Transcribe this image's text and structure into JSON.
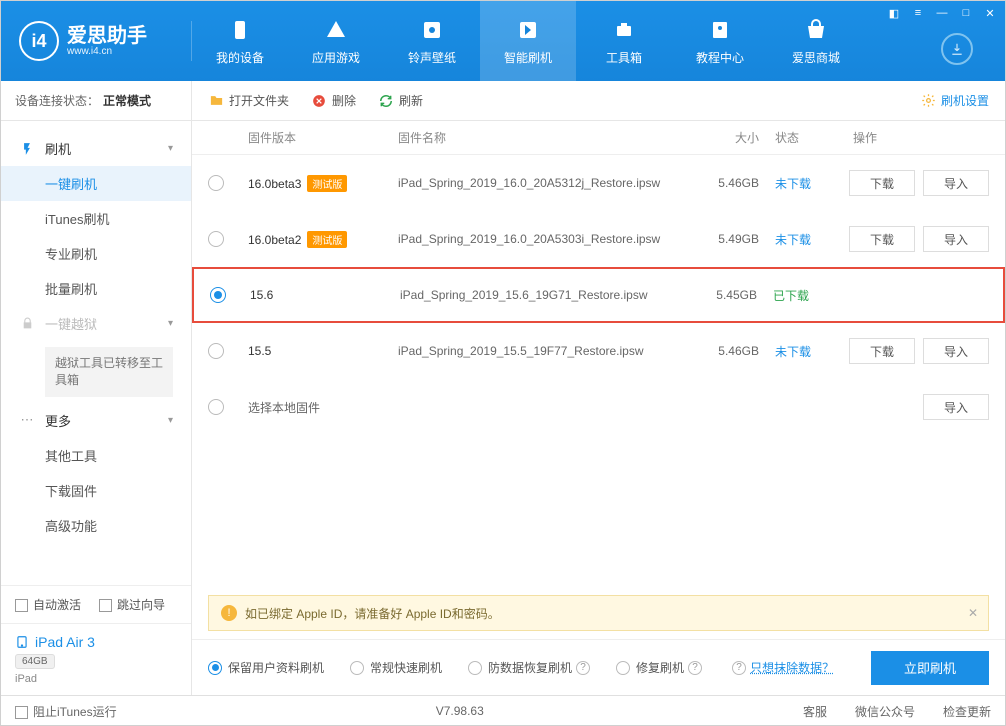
{
  "brand": {
    "name": "爱思助手",
    "site": "www.i4.cn",
    "badge": "i4"
  },
  "nav": {
    "items": [
      {
        "label": "我的设备",
        "icon": "device"
      },
      {
        "label": "应用游戏",
        "icon": "apps"
      },
      {
        "label": "铃声壁纸",
        "icon": "music"
      },
      {
        "label": "智能刷机",
        "icon": "flash"
      },
      {
        "label": "工具箱",
        "icon": "tools"
      },
      {
        "label": "教程中心",
        "icon": "book"
      },
      {
        "label": "爱思商城",
        "icon": "store"
      }
    ],
    "activeIndex": 3
  },
  "status": {
    "label": "设备连接状态：",
    "value": "正常模式"
  },
  "sidebar": {
    "flash": {
      "title": "刷机",
      "items": [
        "一键刷机",
        "iTunes刷机",
        "专业刷机",
        "批量刷机"
      ],
      "activeIndex": 0
    },
    "jailbreak": {
      "title": "一键越狱",
      "note": "越狱工具已转移至工具箱"
    },
    "more": {
      "title": "更多",
      "items": [
        "其他工具",
        "下载固件",
        "高级功能"
      ]
    },
    "autoActivate": "自动激活",
    "skipGuide": "跳过向导"
  },
  "device": {
    "name": "iPad Air 3",
    "storage": "64GB",
    "type": "iPad"
  },
  "toolbar": {
    "openFolder": "打开文件夹",
    "delete": "删除",
    "refresh": "刷新",
    "settings": "刷机设置"
  },
  "table": {
    "headers": {
      "version": "固件版本",
      "name": "固件名称",
      "size": "大小",
      "status": "状态",
      "action": "操作"
    },
    "betaTag": "测试版",
    "btnDownload": "下载",
    "btnImport": "导入",
    "localFirmware": "选择本地固件",
    "statusLabels": {
      "notDownloaded": "未下载",
      "downloaded": "已下载"
    },
    "rows": [
      {
        "version": "16.0beta3",
        "beta": true,
        "name": "iPad_Spring_2019_16.0_20A5312j_Restore.ipsw",
        "size": "5.46GB",
        "status": "notDownloaded",
        "selected": false,
        "showActions": true
      },
      {
        "version": "16.0beta2",
        "beta": true,
        "name": "iPad_Spring_2019_16.0_20A5303i_Restore.ipsw",
        "size": "5.49GB",
        "status": "notDownloaded",
        "selected": false,
        "showActions": true
      },
      {
        "version": "15.6",
        "beta": false,
        "name": "iPad_Spring_2019_15.6_19G71_Restore.ipsw",
        "size": "5.45GB",
        "status": "downloaded",
        "selected": true,
        "showActions": false,
        "highlight": true
      },
      {
        "version": "15.5",
        "beta": false,
        "name": "iPad_Spring_2019_15.5_19F77_Restore.ipsw",
        "size": "5.46GB",
        "status": "notDownloaded",
        "selected": false,
        "showActions": true
      }
    ]
  },
  "notice": "如已绑定 Apple ID，请准备好 Apple ID和密码。",
  "flashOptions": {
    "items": [
      "保留用户资料刷机",
      "常规快速刷机",
      "防数据恢复刷机",
      "修复刷机"
    ],
    "selectedIndex": 0,
    "eraseLink": "只想抹除数据？",
    "button": "立即刷机"
  },
  "footer": {
    "blockItunes": "阻止iTunes运行",
    "version": "V7.98.63",
    "links": [
      "客服",
      "微信公众号",
      "检查更新"
    ]
  }
}
